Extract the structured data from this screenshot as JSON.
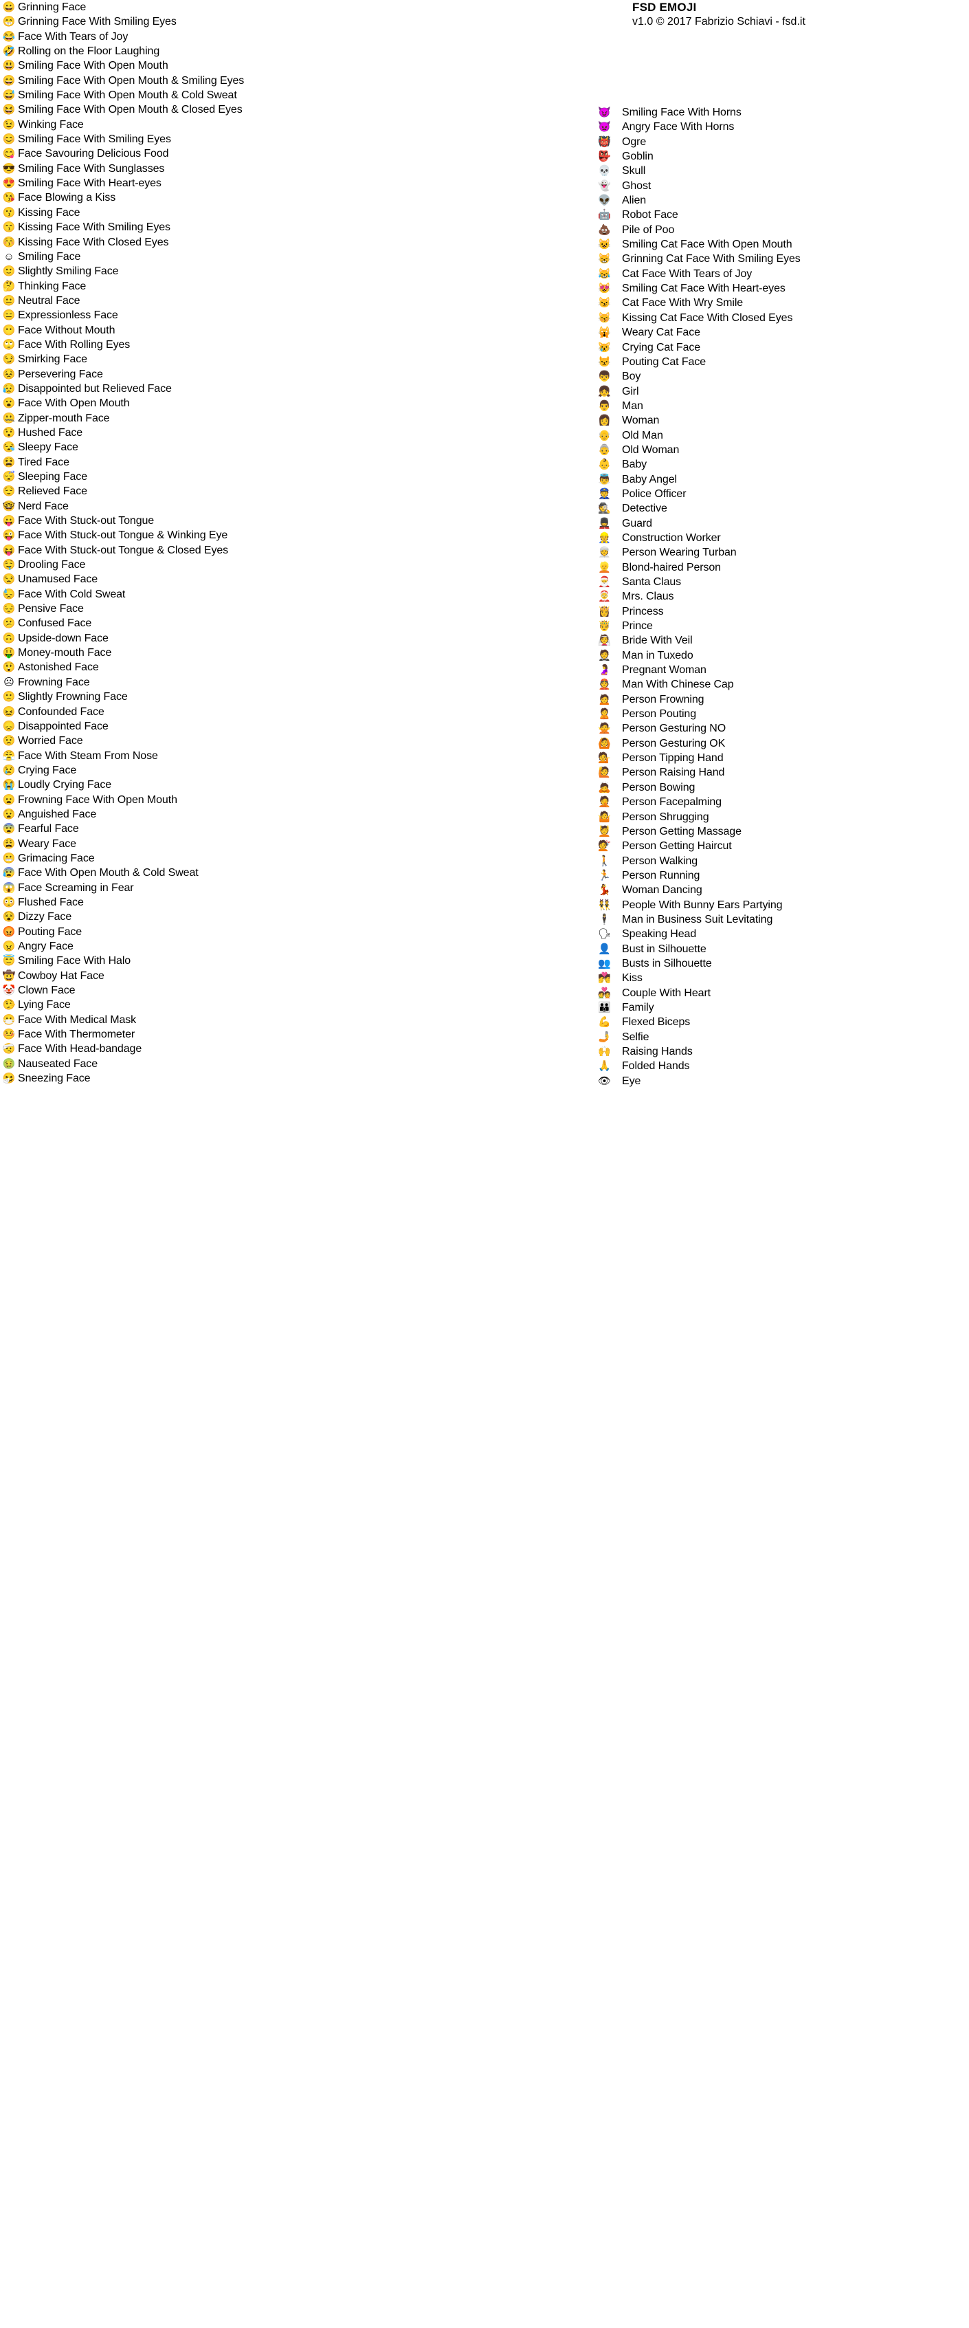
{
  "header": {
    "title": "FSD EMOJI",
    "subtitle": "v1.0 © 2017 Fabrizio Schiavi - fsd.it"
  },
  "document": {
    "kind": "font-specimen",
    "ink_color": "#000000",
    "paper_color": "#ffffff",
    "columns": 2
  },
  "left_column": [
    {
      "glyph": "😀",
      "label": "Grinning Face"
    },
    {
      "glyph": "😁",
      "label": "Grinning Face With Smiling Eyes"
    },
    {
      "glyph": "😂",
      "label": "Face With Tears of Joy"
    },
    {
      "glyph": "🤣",
      "label": "Rolling on the Floor Laughing"
    },
    {
      "glyph": "😃",
      "label": "Smiling Face With Open Mouth"
    },
    {
      "glyph": "😄",
      "label": "Smiling Face With Open Mouth & Smiling Eyes"
    },
    {
      "glyph": "😅",
      "label": "Smiling Face With Open Mouth & Cold Sweat"
    },
    {
      "glyph": "😆",
      "label": "Smiling Face With Open Mouth & Closed Eyes"
    },
    {
      "glyph": "😉",
      "label": "Winking Face"
    },
    {
      "glyph": "😊",
      "label": "Smiling Face With Smiling Eyes"
    },
    {
      "glyph": "😋",
      "label": "Face Savouring Delicious Food"
    },
    {
      "glyph": "😎",
      "label": "Smiling Face With Sunglasses"
    },
    {
      "glyph": "😍",
      "label": "Smiling Face With Heart-eyes"
    },
    {
      "glyph": "😘",
      "label": "Face Blowing a Kiss"
    },
    {
      "glyph": "😗",
      "label": "Kissing Face"
    },
    {
      "glyph": "😙",
      "label": "Kissing Face With Smiling Eyes"
    },
    {
      "glyph": "😚",
      "label": "Kissing Face With Closed Eyes"
    },
    {
      "glyph": "☺",
      "label": "Smiling Face"
    },
    {
      "glyph": "🙂",
      "label": "Slightly Smiling Face"
    },
    {
      "glyph": "🤔",
      "label": "Thinking Face"
    },
    {
      "glyph": "😐",
      "label": "Neutral Face"
    },
    {
      "glyph": "😑",
      "label": "Expressionless Face"
    },
    {
      "glyph": "😶",
      "label": "Face Without Mouth"
    },
    {
      "glyph": "🙄",
      "label": "Face With Rolling Eyes"
    },
    {
      "glyph": "😏",
      "label": "Smirking Face"
    },
    {
      "glyph": "😣",
      "label": "Persevering Face"
    },
    {
      "glyph": "😥",
      "label": "Disappointed but Relieved Face"
    },
    {
      "glyph": "😮",
      "label": "Face With Open Mouth"
    },
    {
      "glyph": "🤐",
      "label": "Zipper-mouth Face"
    },
    {
      "glyph": "😯",
      "label": "Hushed Face"
    },
    {
      "glyph": "😪",
      "label": "Sleepy Face"
    },
    {
      "glyph": "😫",
      "label": "Tired Face"
    },
    {
      "glyph": "😴",
      "label": "Sleeping Face"
    },
    {
      "glyph": "😌",
      "label": "Relieved Face"
    },
    {
      "glyph": "🤓",
      "label": "Nerd Face"
    },
    {
      "glyph": "😛",
      "label": "Face With Stuck-out Tongue"
    },
    {
      "glyph": "😜",
      "label": "Face With Stuck-out Tongue & Winking Eye"
    },
    {
      "glyph": "😝",
      "label": "Face With Stuck-out Tongue & Closed Eyes"
    },
    {
      "glyph": "🤤",
      "label": "Drooling Face"
    },
    {
      "glyph": "😒",
      "label": "Unamused Face"
    },
    {
      "glyph": "😓",
      "label": "Face With Cold Sweat"
    },
    {
      "glyph": "😔",
      "label": "Pensive Face"
    },
    {
      "glyph": "😕",
      "label": "Confused Face"
    },
    {
      "glyph": "🙃",
      "label": "Upside-down Face"
    },
    {
      "glyph": "🤑",
      "label": "Money-mouth Face"
    },
    {
      "glyph": "😲",
      "label": "Astonished Face"
    },
    {
      "glyph": "☹",
      "label": "Frowning Face"
    },
    {
      "glyph": "🙁",
      "label": "Slightly Frowning Face"
    },
    {
      "glyph": "😖",
      "label": "Confounded Face"
    },
    {
      "glyph": "😞",
      "label": "Disappointed Face"
    },
    {
      "glyph": "😟",
      "label": "Worried Face"
    },
    {
      "glyph": "😤",
      "label": "Face With Steam From Nose"
    },
    {
      "glyph": "😢",
      "label": "Crying Face"
    },
    {
      "glyph": "😭",
      "label": "Loudly Crying Face"
    },
    {
      "glyph": "😦",
      "label": "Frowning Face With Open Mouth"
    },
    {
      "glyph": "😧",
      "label": "Anguished Face"
    },
    {
      "glyph": "😨",
      "label": "Fearful Face"
    },
    {
      "glyph": "😩",
      "label": "Weary Face"
    },
    {
      "glyph": "😬",
      "label": "Grimacing Face"
    },
    {
      "glyph": "😰",
      "label": "Face With Open Mouth & Cold Sweat"
    },
    {
      "glyph": "😱",
      "label": "Face Screaming in Fear"
    },
    {
      "glyph": "😳",
      "label": "Flushed Face"
    },
    {
      "glyph": "😵",
      "label": "Dizzy Face"
    },
    {
      "glyph": "😡",
      "label": "Pouting Face"
    },
    {
      "glyph": "😠",
      "label": "Angry Face"
    },
    {
      "glyph": "😇",
      "label": "Smiling Face With Halo"
    },
    {
      "glyph": "🤠",
      "label": "Cowboy Hat Face"
    },
    {
      "glyph": "🤡",
      "label": "Clown Face"
    },
    {
      "glyph": "🤥",
      "label": "Lying Face"
    },
    {
      "glyph": "😷",
      "label": "Face With Medical Mask"
    },
    {
      "glyph": "🤒",
      "label": "Face With Thermometer"
    },
    {
      "glyph": "🤕",
      "label": "Face With Head-bandage"
    },
    {
      "glyph": "🤢",
      "label": "Nauseated Face"
    },
    {
      "glyph": "🤧",
      "label": "Sneezing Face"
    }
  ],
  "right_column": [
    {
      "glyph": "😈",
      "label": "Smiling Face With Horns"
    },
    {
      "glyph": "👿",
      "label": "Angry Face With Horns"
    },
    {
      "glyph": "👹",
      "label": "Ogre"
    },
    {
      "glyph": "👺",
      "label": "Goblin"
    },
    {
      "glyph": "💀",
      "label": "Skull"
    },
    {
      "glyph": "👻",
      "label": "Ghost"
    },
    {
      "glyph": "👽",
      "label": "Alien"
    },
    {
      "glyph": "🤖",
      "label": "Robot Face"
    },
    {
      "glyph": "💩",
      "label": "Pile of Poo"
    },
    {
      "glyph": "😺",
      "label": "Smiling Cat Face With Open Mouth"
    },
    {
      "glyph": "😸",
      "label": "Grinning Cat Face With Smiling Eyes"
    },
    {
      "glyph": "😹",
      "label": "Cat Face With Tears of Joy"
    },
    {
      "glyph": "😻",
      "label": "Smiling Cat Face With Heart-eyes"
    },
    {
      "glyph": "😼",
      "label": "Cat Face With Wry Smile"
    },
    {
      "glyph": "😽",
      "label": "Kissing Cat Face With Closed Eyes"
    },
    {
      "glyph": "🙀",
      "label": "Weary Cat Face"
    },
    {
      "glyph": "😿",
      "label": "Crying Cat Face"
    },
    {
      "glyph": "😾",
      "label": "Pouting Cat Face"
    },
    {
      "glyph": "👦",
      "label": "Boy"
    },
    {
      "glyph": "👧",
      "label": "Girl"
    },
    {
      "glyph": "👨",
      "label": "Man"
    },
    {
      "glyph": "👩",
      "label": "Woman"
    },
    {
      "glyph": "👴",
      "label": "Old Man"
    },
    {
      "glyph": "👵",
      "label": "Old Woman"
    },
    {
      "glyph": "👶",
      "label": "Baby"
    },
    {
      "glyph": "👼",
      "label": "Baby Angel"
    },
    {
      "glyph": "👮",
      "label": "Police Officer"
    },
    {
      "glyph": "🕵",
      "label": "Detective"
    },
    {
      "glyph": "💂",
      "label": "Guard"
    },
    {
      "glyph": "👷",
      "label": "Construction Worker"
    },
    {
      "glyph": "👳",
      "label": "Person Wearing Turban"
    },
    {
      "glyph": "👱",
      "label": "Blond-haired Person"
    },
    {
      "glyph": "🎅",
      "label": "Santa Claus"
    },
    {
      "glyph": "🤶",
      "label": "Mrs. Claus"
    },
    {
      "glyph": "👸",
      "label": "Princess"
    },
    {
      "glyph": "🤴",
      "label": "Prince"
    },
    {
      "glyph": "👰",
      "label": "Bride With Veil"
    },
    {
      "glyph": "🤵",
      "label": "Man in Tuxedo"
    },
    {
      "glyph": "🤰",
      "label": "Pregnant Woman"
    },
    {
      "glyph": "👲",
      "label": "Man With Chinese Cap"
    },
    {
      "glyph": "🙍",
      "label": "Person Frowning"
    },
    {
      "glyph": "🙎",
      "label": "Person Pouting"
    },
    {
      "glyph": "🙅",
      "label": "Person Gesturing NO"
    },
    {
      "glyph": "🙆",
      "label": "Person Gesturing OK"
    },
    {
      "glyph": "💁",
      "label": "Person Tipping Hand"
    },
    {
      "glyph": "🙋",
      "label": "Person Raising Hand"
    },
    {
      "glyph": "🙇",
      "label": "Person Bowing"
    },
    {
      "glyph": "🤦",
      "label": "Person Facepalming"
    },
    {
      "glyph": "🤷",
      "label": "Person Shrugging"
    },
    {
      "glyph": "💆",
      "label": "Person Getting Massage"
    },
    {
      "glyph": "💇",
      "label": "Person Getting Haircut"
    },
    {
      "glyph": "🚶",
      "label": "Person Walking"
    },
    {
      "glyph": "🏃",
      "label": "Person Running"
    },
    {
      "glyph": "💃",
      "label": "Woman Dancing"
    },
    {
      "glyph": "👯",
      "label": "People With Bunny Ears Partying"
    },
    {
      "glyph": "🕴",
      "label": "Man in Business Suit Levitating"
    },
    {
      "glyph": "🗣",
      "label": "Speaking Head"
    },
    {
      "glyph": "👤",
      "label": "Bust in Silhouette"
    },
    {
      "glyph": "👥",
      "label": "Busts in Silhouette"
    },
    {
      "glyph": "💏",
      "label": "Kiss"
    },
    {
      "glyph": "💑",
      "label": "Couple With Heart"
    },
    {
      "glyph": "👪",
      "label": "Family"
    },
    {
      "glyph": "💪",
      "label": "Flexed Biceps"
    },
    {
      "glyph": "🤳",
      "label": "Selfie"
    },
    {
      "glyph": "🙌",
      "label": "Raising Hands"
    },
    {
      "glyph": "🙏",
      "label": "Folded Hands"
    },
    {
      "glyph": "👁",
      "label": "Eye"
    }
  ]
}
